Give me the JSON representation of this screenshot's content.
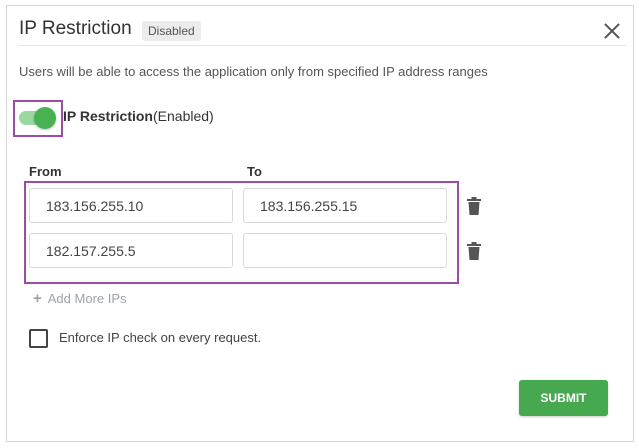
{
  "dialog": {
    "title": "IP Restriction",
    "status_badge": "Disabled",
    "close_icon": "close-icon",
    "description": "Users will be able to access the application only from specified IP address ranges"
  },
  "toggle": {
    "label": "IP Restriction",
    "state_text": "(Enabled)",
    "on": true,
    "color": "#48b151"
  },
  "ranges": {
    "from_header": "From",
    "to_header": "To",
    "rows": [
      {
        "from": "183.156.255.10",
        "to": "183.156.255.15",
        "delete_icon": "trash-icon"
      },
      {
        "from": "182.157.255.5",
        "to": "",
        "delete_icon": "trash-icon"
      }
    ],
    "add_more_label": "Add More IPs"
  },
  "enforce": {
    "label": "Enforce IP check on every request.",
    "checked": false
  },
  "actions": {
    "submit_label": "SUBMIT",
    "submit_color": "#46a84f"
  }
}
